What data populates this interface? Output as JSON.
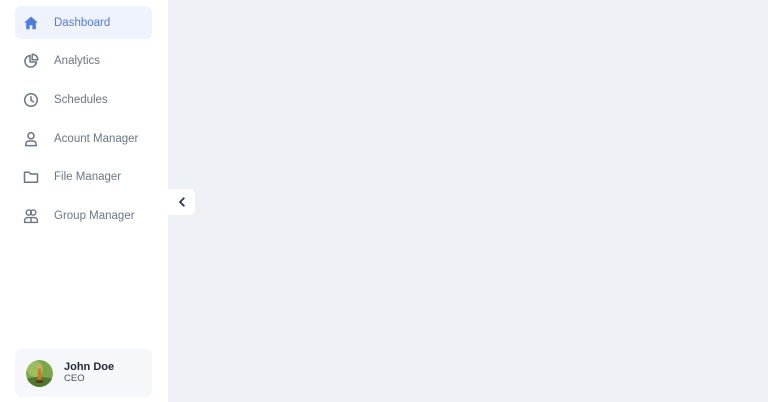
{
  "sidebar": {
    "items": [
      {
        "label": "Dashboard",
        "icon": "home-icon",
        "active": true
      },
      {
        "label": "Analytics",
        "icon": "pie-chart-icon",
        "active": false
      },
      {
        "label": "Schedules",
        "icon": "clock-icon",
        "active": false
      },
      {
        "label": "Acount Manager",
        "icon": "user-icon",
        "active": false
      },
      {
        "label": "File Manager",
        "icon": "folder-icon",
        "active": false
      },
      {
        "label": "Group Manager",
        "icon": "users-icon",
        "active": false
      }
    ],
    "collapse_icon": "chevron-left-icon"
  },
  "user": {
    "name": "John Doe",
    "role": "CEO"
  },
  "colors": {
    "accent": "#4f7be8",
    "active_bg": "#eef3fd",
    "sidebar_bg": "#ffffff",
    "main_bg": "#edf1f6",
    "text_muted": "#6b7683"
  }
}
